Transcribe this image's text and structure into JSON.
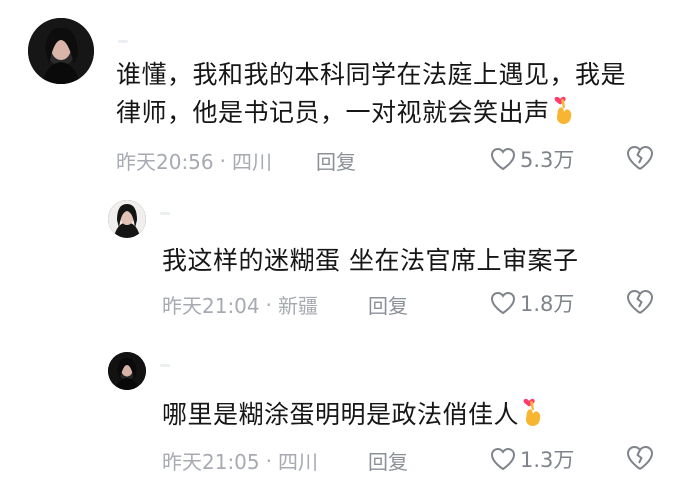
{
  "comments": [
    {
      "lines": [
        "谁懂，我和我的本科同学在法庭上遇见，我是",
        "律师，他是书记员，一对视就会笑出声"
      ],
      "time": "昨天20:56",
      "location": "四川",
      "reply_label": "回复",
      "likes": "5.3万",
      "emoji": "finger-heart-icon"
    },
    {
      "lines": [
        "我这样的迷糊蛋 坐在法官席上审案子"
      ],
      "time": "昨天21:04",
      "location": "新疆",
      "reply_label": "回复",
      "likes": "1.8万"
    },
    {
      "lines": [
        "哪里是糊涂蛋明明是政法俏佳人"
      ],
      "time": "昨天21:05",
      "location": "四川",
      "reply_label": "回复",
      "likes": "1.3万",
      "emoji": "finger-heart-icon"
    }
  ],
  "colors": {
    "meta": "#a7aab2",
    "text": "#161616",
    "emoji_heart": "#ff3b6b",
    "emoji_hand": "#f7b531"
  }
}
